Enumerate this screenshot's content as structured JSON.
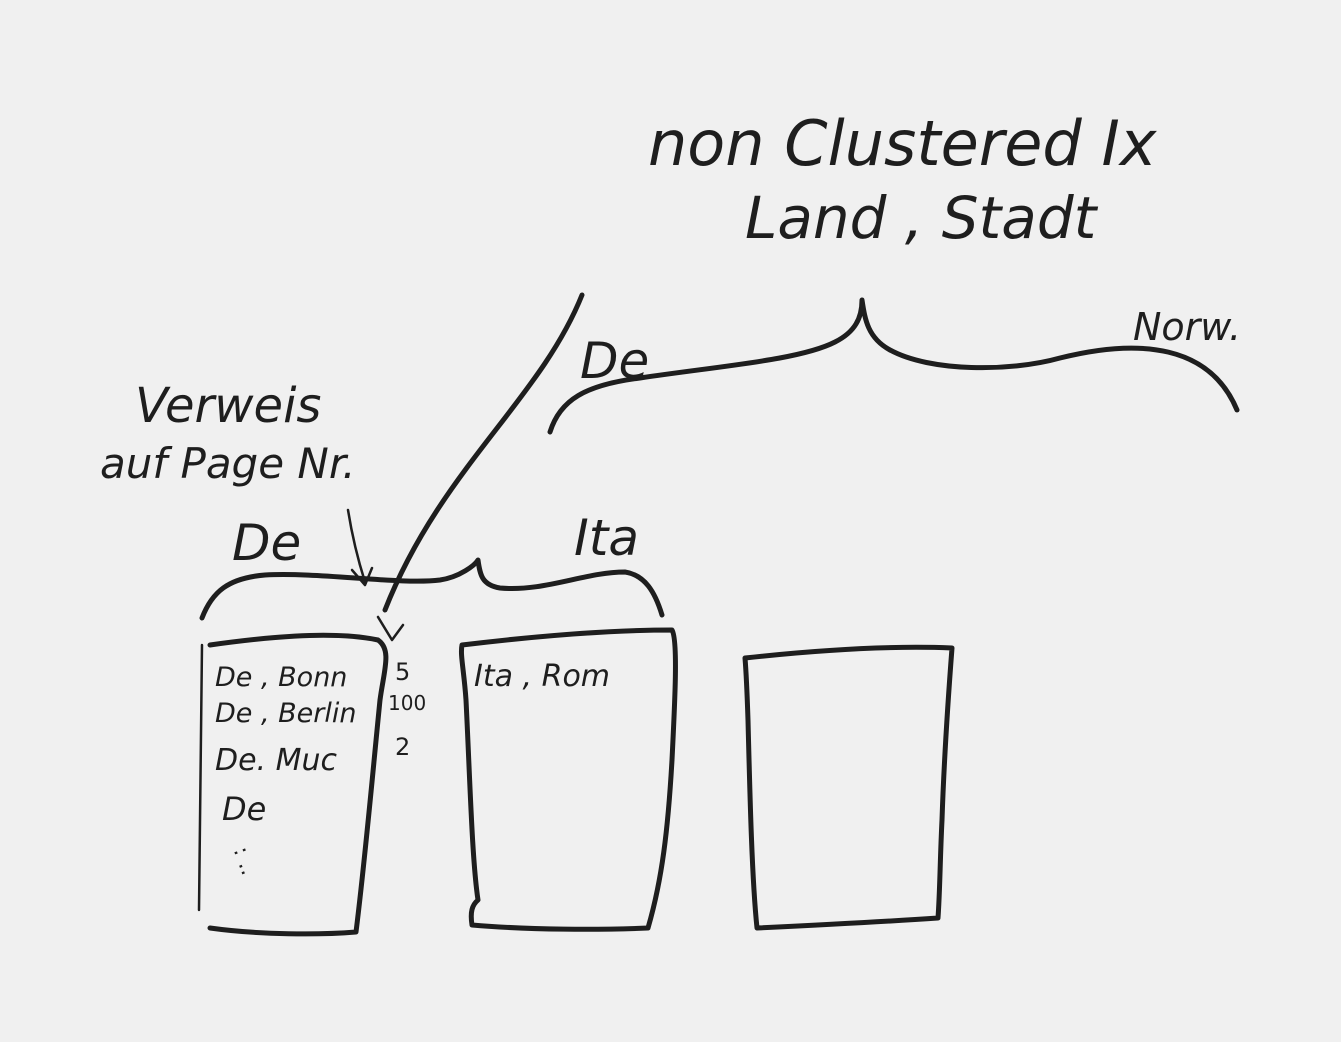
{
  "title": {
    "line1": "non Clustered Ix",
    "line2": "Land , Stadt"
  },
  "root_labels": {
    "left": "De",
    "right": "Norw."
  },
  "annotation": {
    "line1": "Verweis",
    "line2": "auf Page Nr."
  },
  "level_labels": {
    "left": "De",
    "right": "Ita"
  },
  "pages": [
    {
      "entries": [
        {
          "key": "De , Bonn",
          "ref": "5"
        },
        {
          "key": "De , Berlin",
          "ref": "100"
        },
        {
          "key": "De. Muc",
          "ref": "2"
        },
        {
          "key": "De",
          "ref": ""
        }
      ],
      "ellipsis": ": .."
    },
    {
      "entries": [
        {
          "key": "Ita , Rom",
          "ref": ""
        }
      ]
    },
    {
      "entries": []
    }
  ],
  "colors": {
    "background": "#f0f0f0",
    "ink": "#1e1e1e"
  }
}
